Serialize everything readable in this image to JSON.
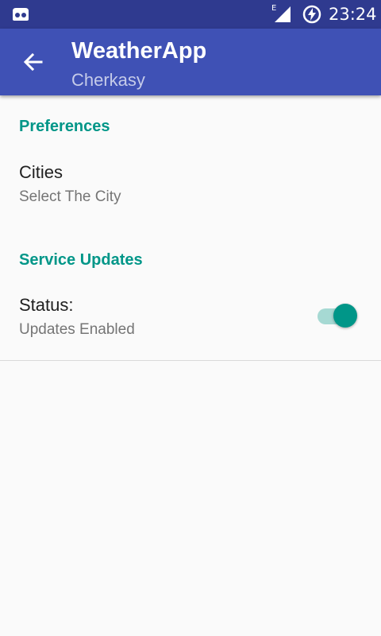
{
  "status_bar": {
    "network_type": "E",
    "time": "23:24"
  },
  "app_bar": {
    "title": "WeatherApp",
    "subtitle": "Cherkasy"
  },
  "preferences": {
    "header": "Preferences",
    "cities_title": "Cities",
    "cities_summary": "Select The City"
  },
  "service_updates": {
    "header": "Service Updates",
    "status_title": "Status:",
    "status_summary": "Updates Enabled",
    "enabled": true
  },
  "colors": {
    "status_bar": "#2f3a8f",
    "app_bar": "#3f51b5",
    "accent": "#009688"
  }
}
